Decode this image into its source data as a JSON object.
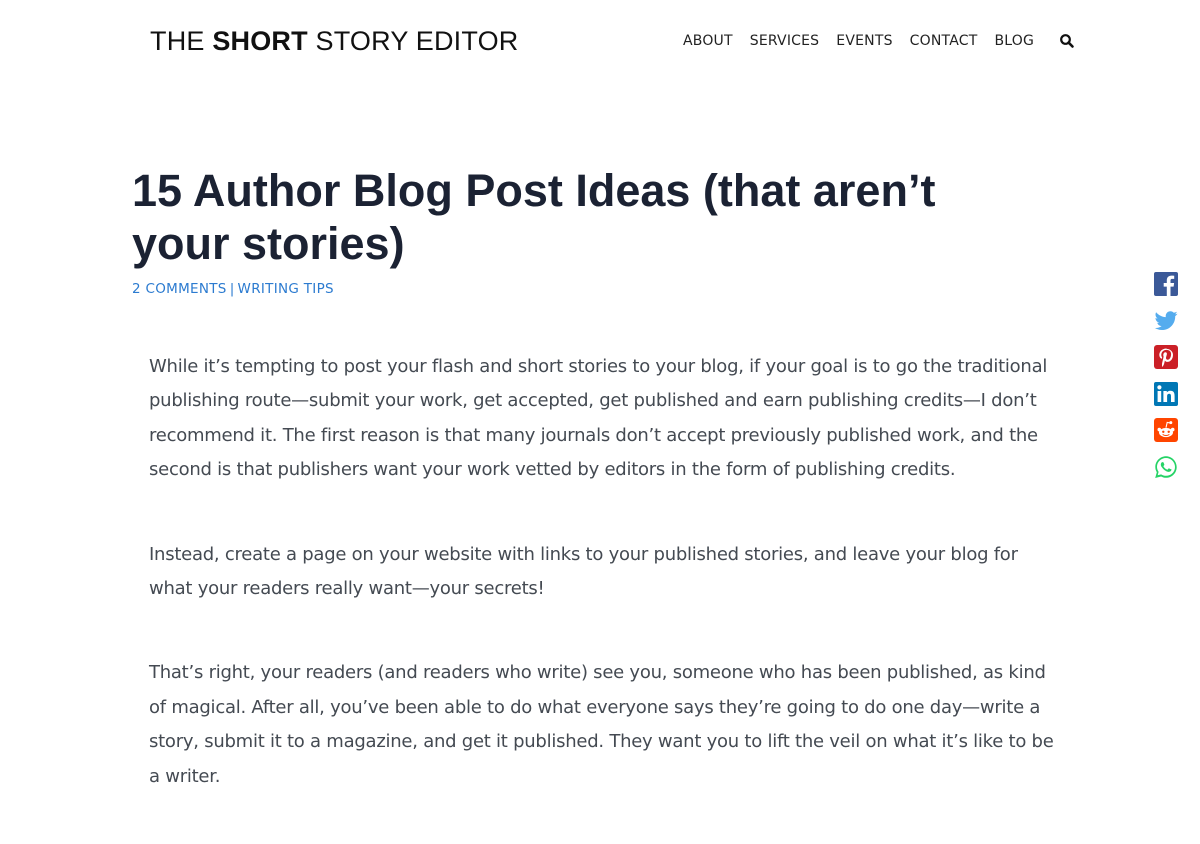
{
  "header": {
    "logo_pre": "THE ",
    "logo_bold": "SHORT",
    "logo_post": " STORY EDITOR",
    "nav": {
      "about": "ABOUT",
      "services": "SERVICES",
      "events": "EVENTS",
      "contact": "CONTACT",
      "blog": "BLOG"
    },
    "search_icon": "search-icon"
  },
  "post": {
    "title": "15 Author Blog Post Ideas (that aren’t your stories)",
    "comments_link": "2 COMMENTS",
    "meta_separator": "|",
    "category_link": "WRITING TIPS",
    "paragraphs": [
      "While it’s tempting to post your flash and short stories to your blog, if your goal is to go the traditional publishing route—submit your work, get accepted, get published and earn publishing credits—I don’t recommend it. The first reason is that many journals don’t accept previously published work, and the second is that publishers want your work vetted by editors in the form of publishing credits.",
      "Instead, create a page on your website with links to your published stories, and leave your blog for what your readers really want—your secrets!",
      "That’s right, your readers (and readers who write) see you, someone who has been published, as kind of magical. After all, you’ve been able to do what everyone says they’re going to do one day—write a story, submit it to a magazine, and get it published. They want you to lift the veil on what it’s like to be a writer."
    ]
  },
  "share": [
    {
      "name": "facebook",
      "icon": "facebook-icon",
      "color": "#3b5998"
    },
    {
      "name": "twitter",
      "icon": "twitter-icon",
      "color": "#55acee"
    },
    {
      "name": "pinterest",
      "icon": "pinterest-icon",
      "color": "#cb2027"
    },
    {
      "name": "linkedin",
      "icon": "linkedin-icon",
      "color": "#0077b5"
    },
    {
      "name": "reddit",
      "icon": "reddit-icon",
      "color": "#ff4500"
    },
    {
      "name": "whatsapp",
      "icon": "whatsapp-icon",
      "color": "#25d366"
    }
  ],
  "colors": {
    "accent_link": "#2c7bd0",
    "title": "#1b2233",
    "body_text": "#444a52"
  }
}
